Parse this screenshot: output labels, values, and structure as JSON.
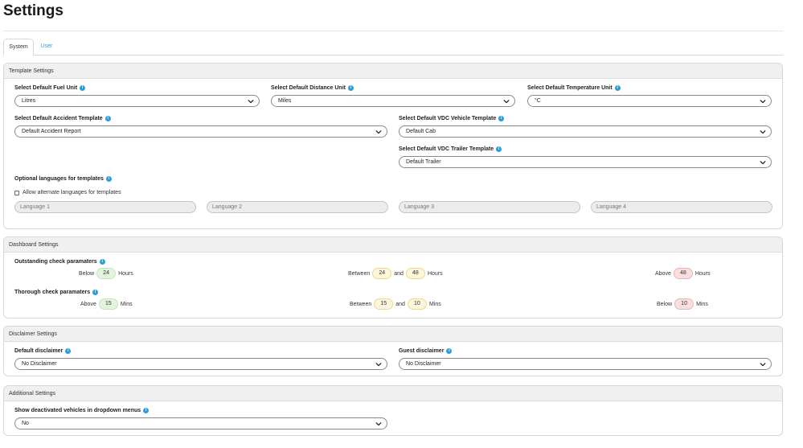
{
  "page": {
    "title": "Settings"
  },
  "tabs": [
    {
      "label": "System"
    },
    {
      "label": "User"
    }
  ],
  "template_settings": {
    "header": "Template Settings",
    "fuel": {
      "label": "Select Default Fuel Unit",
      "value": "Litres"
    },
    "distance": {
      "label": "Select Default Distance Unit",
      "value": "Miles"
    },
    "temperature": {
      "label": "Select Default Temperature Unit",
      "value": "°C"
    },
    "accident": {
      "label": "Select Default Accident Template",
      "value": "Default Accident Report"
    },
    "vdc_vehicle": {
      "label": "Select Default VDC Vehicle Template",
      "value": "Default Cab"
    },
    "vdc_trailer": {
      "label": "Select Default VDC Trailer Template",
      "value": "Default Trailer"
    },
    "languages": {
      "label": "Optional languages for templates",
      "checkbox_label": "Allow alternate languages for templates",
      "fields": [
        "Language 1",
        "Language 2",
        "Language 3",
        "Language 4"
      ]
    }
  },
  "dashboard_settings": {
    "header": "Dashboard Settings",
    "outstanding": {
      "label": "Outstanding check paramaters",
      "below": {
        "prefix": "Below",
        "value": "24",
        "unit": "Hours"
      },
      "between": {
        "prefix": "Between",
        "from": "24",
        "and_label": "and",
        "to": "48",
        "unit": "Hours"
      },
      "above": {
        "prefix": "Above",
        "value": "48",
        "unit": "Hours"
      }
    },
    "thorough": {
      "label": "Thorough check paramaters",
      "above": {
        "prefix": "Above",
        "value": "15",
        "unit": "Mins"
      },
      "between": {
        "prefix": "Between",
        "from": "15",
        "and_label": "and",
        "to": "10",
        "unit": "Mins"
      },
      "below": {
        "prefix": "Below",
        "value": "10",
        "unit": "Mins"
      }
    }
  },
  "disclaimer_settings": {
    "header": "Disclaimer Settings",
    "default": {
      "label": "Default disclaimer",
      "value": "No Disclaimer"
    },
    "guest": {
      "label": "Guest disclaimer",
      "value": "No Disclaimer"
    }
  },
  "additional_settings": {
    "header": "Additional Settings",
    "deactivated": {
      "label": "Show deactivated vehicles in dropdown menus",
      "value": "No"
    }
  },
  "colors": {
    "accent": "#2d9cdb",
    "green_pill": "#e4f3de",
    "yellow_pill": "#fdf5dc",
    "red_pill": "#f9e0e0"
  }
}
